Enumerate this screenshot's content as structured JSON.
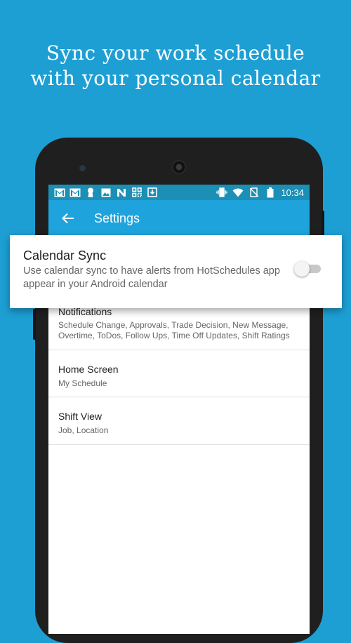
{
  "headline": {
    "line1": "Sync your work schedule",
    "line2": "with your personal calendar"
  },
  "status_bar": {
    "notification_icons": [
      "gmail-icon",
      "gmail-icon",
      "keyhole-icon",
      "image-icon",
      "n-app-icon",
      "qr-icon",
      "download-icon"
    ],
    "system_icons": [
      "vibrate-icon",
      "wifi-icon",
      "no-sim-icon",
      "battery-icon"
    ],
    "time": "10:34"
  },
  "app_bar": {
    "title": "Settings"
  },
  "calendar_sync_card": {
    "title": "Calendar Sync",
    "description": "Use calendar sync to have alerts from HotSchedules app appear in your Android calendar",
    "enabled": false
  },
  "settings_list": [
    {
      "title": "Notifications",
      "subtitle": "Schedule Change, Approvals, Trade Decision, New Message, Overtime, ToDos, Follow Ups, Time Off Updates, Shift Ratings"
    },
    {
      "title": "Home Screen",
      "subtitle": "My Schedule"
    },
    {
      "title": "Shift View",
      "subtitle": "Job, Location"
    }
  ],
  "colors": {
    "background": "#1d9fd4",
    "app_bar": "#1fa3dc",
    "status_bar": "#1b8fb5",
    "phone_body": "#1f1f1f"
  }
}
